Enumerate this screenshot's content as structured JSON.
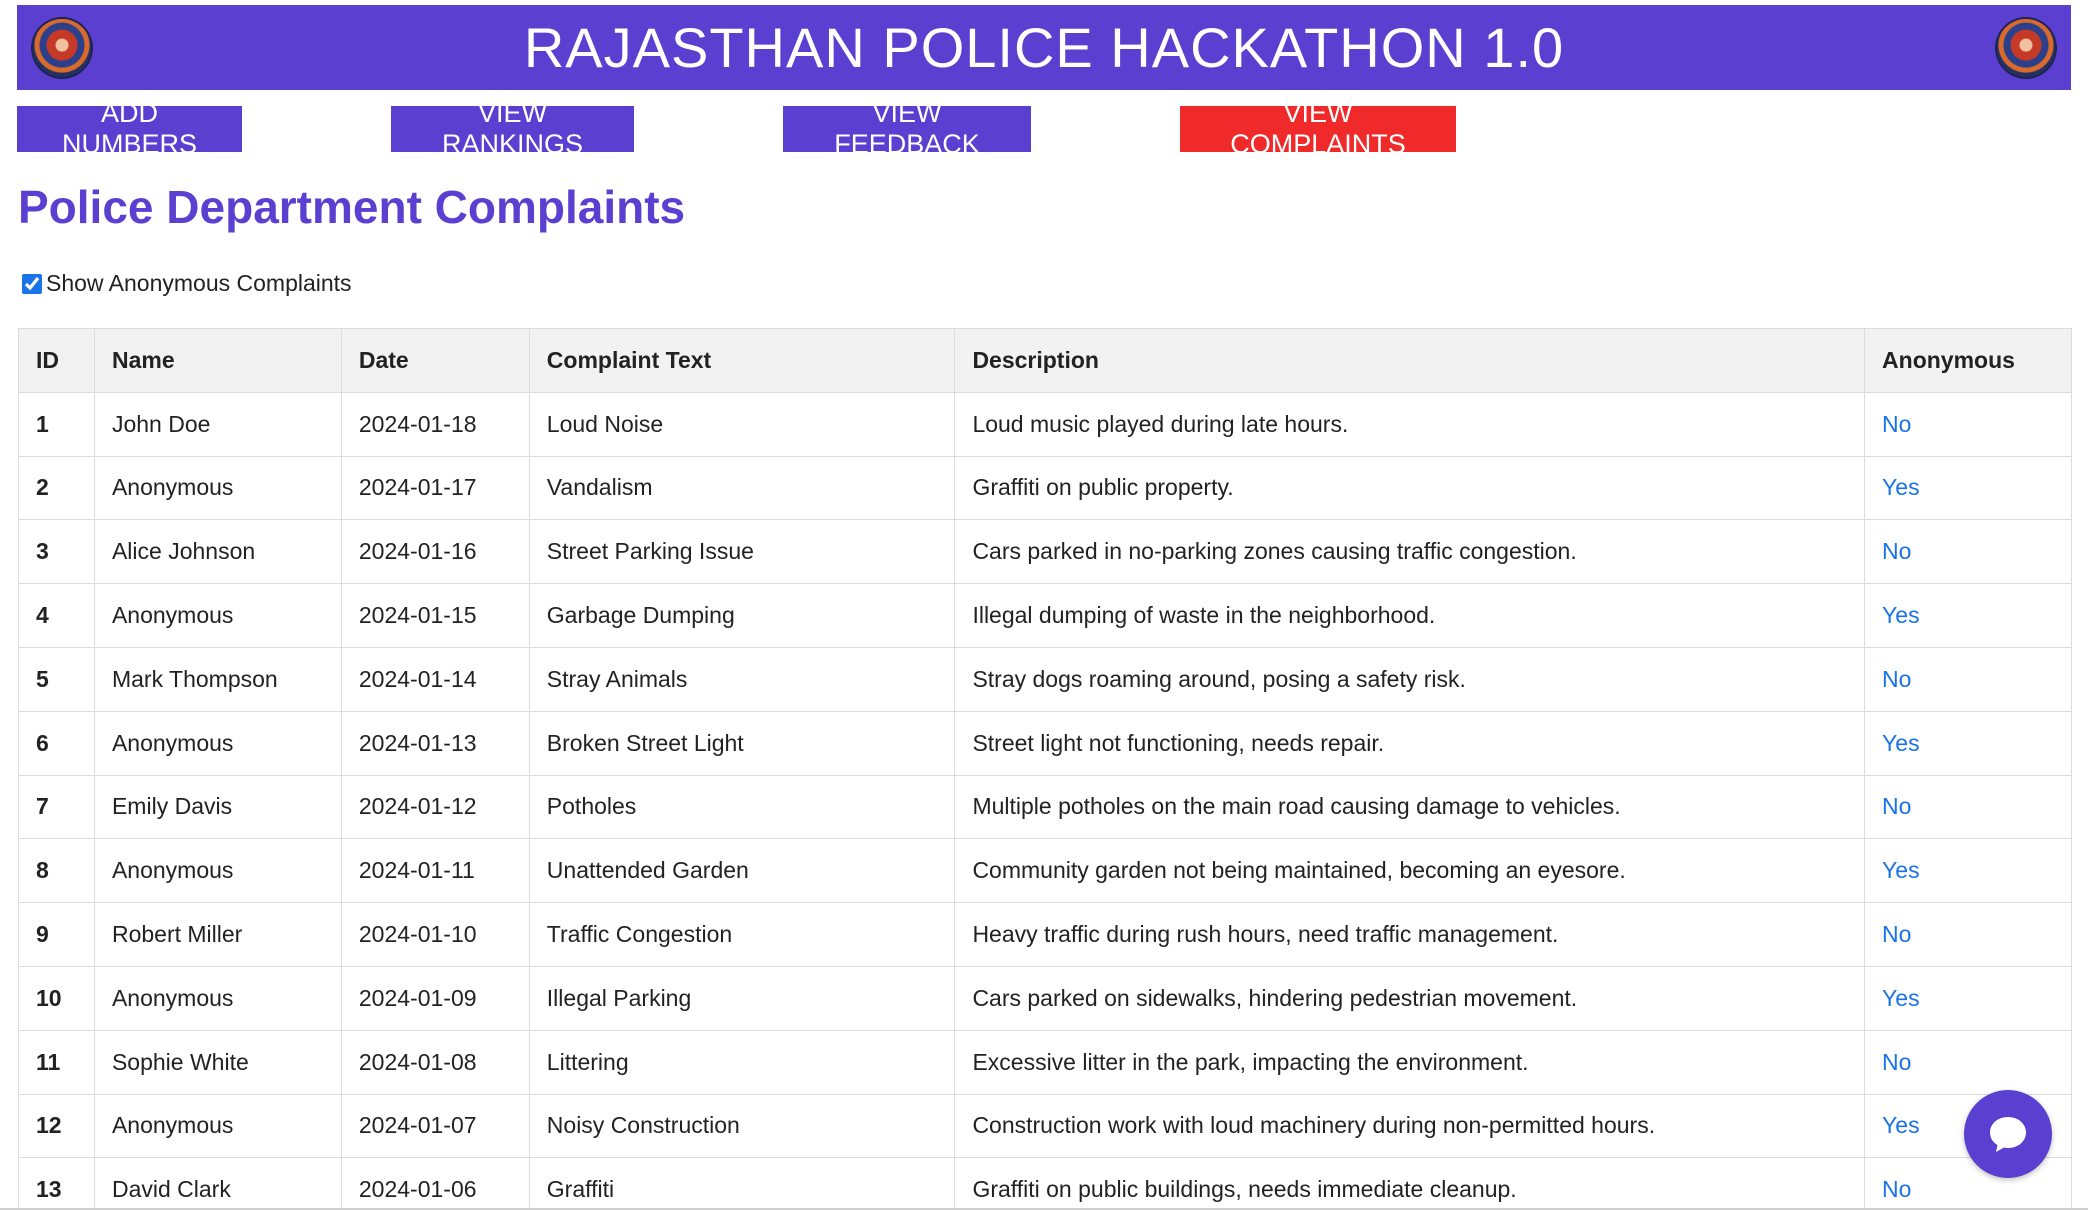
{
  "header": {
    "title": "RAJASTHAN POLICE HACKATHON 1.0",
    "emblem_left": "police-emblem-icon",
    "emblem_right": "police-emblem-icon",
    "background": "#5a3fd1"
  },
  "nav": {
    "add_numbers": "ADD NUMBERS",
    "view_rankings": "VIEW RANKINGS",
    "view_feedback": "VIEW FEEDBACK",
    "view_complaints": "VIEW COMPLAINTS",
    "active": "view_complaints",
    "active_color": "#f02a2a"
  },
  "page_title": "Police Department Complaints",
  "filter": {
    "label": "Show Anonymous Complaints",
    "checked": true
  },
  "table": {
    "columns": [
      "ID",
      "Name",
      "Date",
      "Complaint Text",
      "Description",
      "Anonymous"
    ],
    "rows": [
      [
        "1",
        "John Doe",
        "2024-01-18",
        "Loud Noise",
        "Loud music played during late hours.",
        "No"
      ],
      [
        "2",
        "Anonymous",
        "2024-01-17",
        "Vandalism",
        "Graffiti on public property.",
        "Yes"
      ],
      [
        "3",
        "Alice Johnson",
        "2024-01-16",
        "Street Parking Issue",
        "Cars parked in no-parking zones causing traffic congestion.",
        "No"
      ],
      [
        "4",
        "Anonymous",
        "2024-01-15",
        "Garbage Dumping",
        "Illegal dumping of waste in the neighborhood.",
        "Yes"
      ],
      [
        "5",
        "Mark Thompson",
        "2024-01-14",
        "Stray Animals",
        "Stray dogs roaming around, posing a safety risk.",
        "No"
      ],
      [
        "6",
        "Anonymous",
        "2024-01-13",
        "Broken Street Light",
        "Street light not functioning, needs repair.",
        "Yes"
      ],
      [
        "7",
        "Emily Davis",
        "2024-01-12",
        "Potholes",
        "Multiple potholes on the main road causing damage to vehicles.",
        "No"
      ],
      [
        "8",
        "Anonymous",
        "2024-01-11",
        "Unattended Garden",
        "Community garden not being maintained, becoming an eyesore.",
        "Yes"
      ],
      [
        "9",
        "Robert Miller",
        "2024-01-10",
        "Traffic Congestion",
        "Heavy traffic during rush hours, need traffic management.",
        "No"
      ],
      [
        "10",
        "Anonymous",
        "2024-01-09",
        "Illegal Parking",
        "Cars parked on sidewalks, hindering pedestrian movement.",
        "Yes"
      ],
      [
        "11",
        "Sophie White",
        "2024-01-08",
        "Littering",
        "Excessive litter in the park, impacting the environment.",
        "No"
      ],
      [
        "12",
        "Anonymous",
        "2024-01-07",
        "Noisy Construction",
        "Construction work with loud machinery during non-permitted hours.",
        "Yes"
      ],
      [
        "13",
        "David Clark",
        "2024-01-06",
        "Graffiti",
        "Graffiti on public buildings, needs immediate cleanup.",
        "No"
      ]
    ]
  },
  "chat": {
    "icon": "chat-bubble-icon"
  }
}
